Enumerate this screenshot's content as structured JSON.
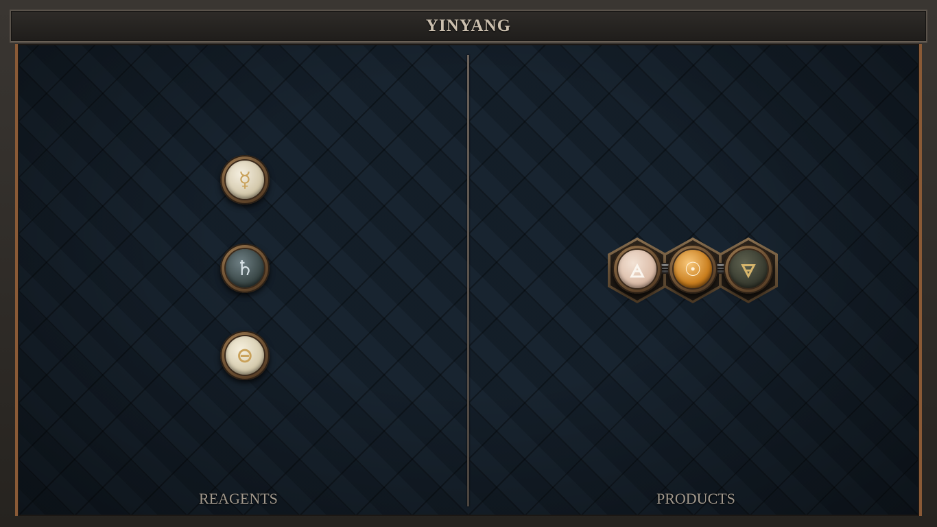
{
  "window": {
    "title": "YINYANG"
  },
  "panels": {
    "reagents": {
      "label": "REAGENTS",
      "atoms": [
        {
          "element": "mercury",
          "symbol": "☿"
        },
        {
          "element": "lead",
          "symbol": "♄"
        },
        {
          "element": "salt",
          "symbol": "⊖"
        }
      ]
    },
    "products": {
      "label": "PRODUCTS",
      "molecule": {
        "atoms": [
          {
            "element": "air",
            "symbol": "🜁"
          },
          {
            "element": "gold",
            "symbol": "☉"
          },
          {
            "element": "earth",
            "symbol": "🜃"
          }
        ],
        "bonds": 2
      }
    }
  },
  "colors": {
    "frame_accent": "#8a5a36",
    "title_text": "#cbbfae",
    "board_bg": "#15202b"
  }
}
